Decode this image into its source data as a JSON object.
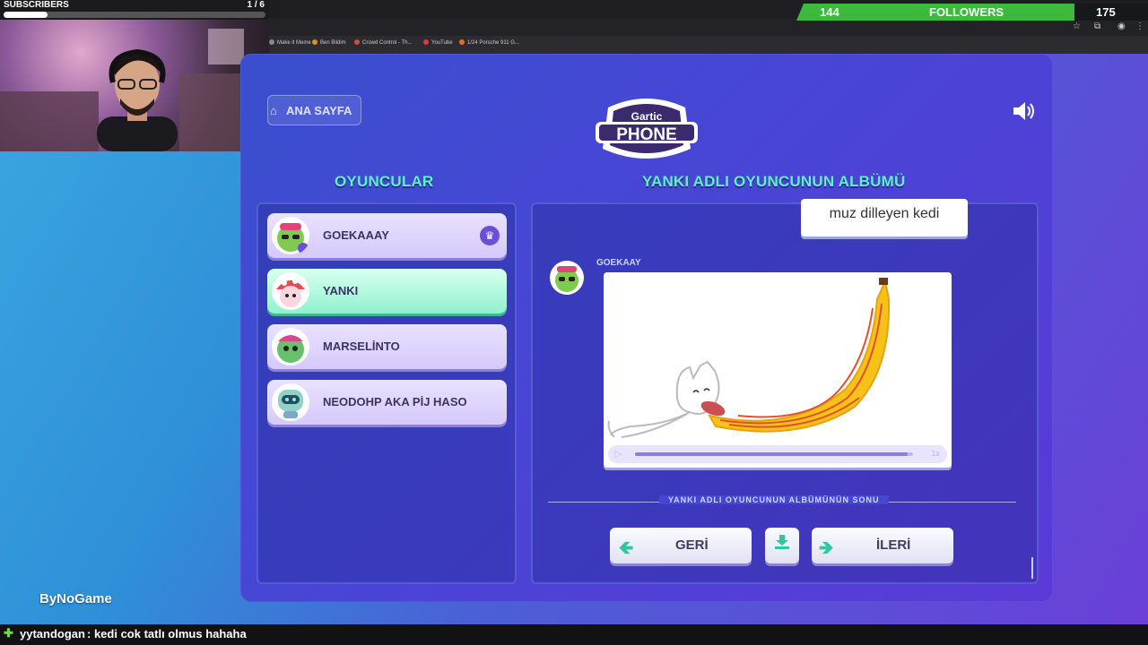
{
  "stream": {
    "subscribers_label": "SUBSCRIBERS",
    "subscribers_count": "1 / 6",
    "subscribers_progress": 0.167,
    "followers_count": "144",
    "followers_label": "FOLLOWERS",
    "followers_goal": "175",
    "watermark": "ByNoGame"
  },
  "browser": {
    "bookmarks": [
      {
        "label": "Make it Meme",
        "color": "#888888"
      },
      {
        "label": "Ben Bildim",
        "color": "#e08a2c"
      },
      {
        "label": "Crowd Control - Th...",
        "color": "#d24c3a"
      },
      {
        "label": "YouTube",
        "color": "#e53935"
      },
      {
        "label": "1/24 Porsche 911 G...",
        "color": "#e86a3a"
      }
    ]
  },
  "game": {
    "home_button": "ANA SAYFA",
    "logo_top": "Gartic",
    "logo_bottom": "PHONE",
    "players_heading": "OYUNCULAR",
    "album_heading": "YANKI ADLI OYUNCUNUN ALBÜMÜ",
    "players": [
      {
        "name": "GOEKAAAY",
        "host": true,
        "active": false
      },
      {
        "name": "YANKI",
        "host": false,
        "active": true
      },
      {
        "name": "MARSELİNTO",
        "host": false,
        "active": false
      },
      {
        "name": "NEODOHP AKA PİJ HASO",
        "host": false,
        "active": false
      }
    ],
    "prompt_text": "muz dilleyen kedi",
    "drawing_author": "GOEKAAY",
    "playback_progress": 0.98,
    "playback_speed": "1x",
    "end_text": "YANKI ADLI OYUNCUNUN ALBÜMÜNÜN SONU",
    "back_button": "GERİ",
    "next_button": "İLERİ",
    "accent_color": "#5ef0c8"
  },
  "chat": {
    "username": "yytandogan",
    "message": ": kedi cok tatlı olmus hahaha"
  }
}
